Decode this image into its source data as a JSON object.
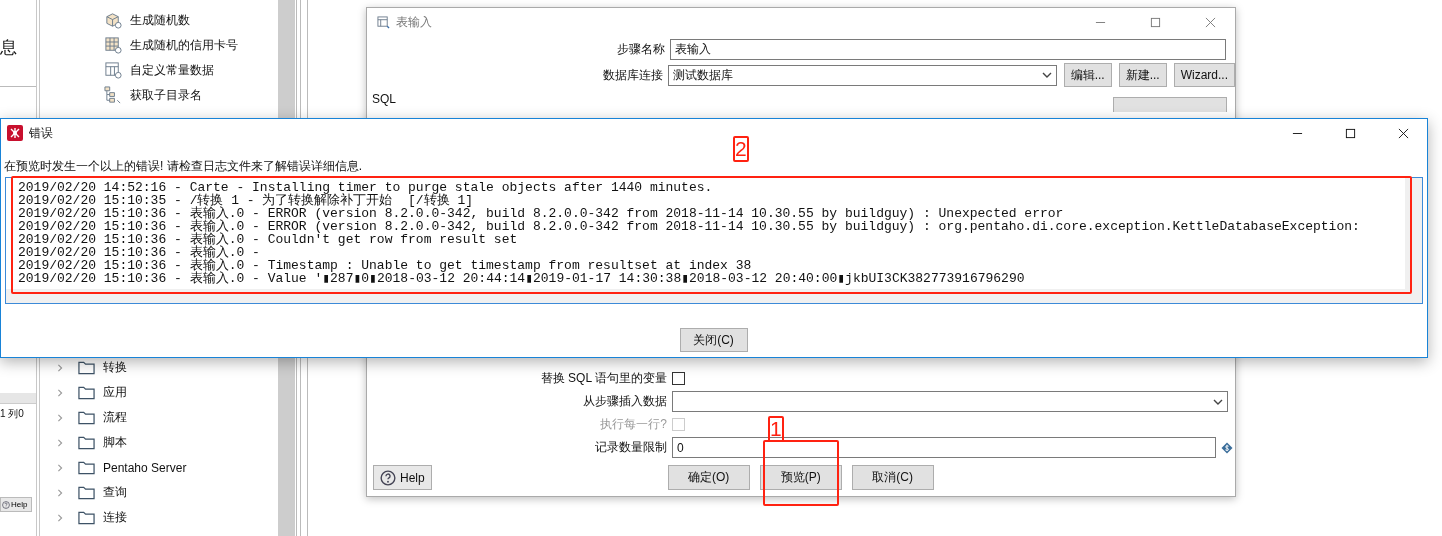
{
  "background_app": {
    "left_panel": {
      "title_fragment": "息",
      "status_fragment": "1 列0",
      "help_button": "Help"
    },
    "tree_top": [
      {
        "label": "生成随机数",
        "kind": "cube"
      },
      {
        "label": "生成随机的信用卡号",
        "kind": "grid"
      },
      {
        "label": "自定义常量数据",
        "kind": "table"
      },
      {
        "label": "获取子目录名",
        "kind": "folders"
      }
    ],
    "tree_bottom": [
      {
        "label": "转换",
        "expanded": false
      },
      {
        "label": "应用",
        "expanded": false
      },
      {
        "label": "流程",
        "expanded": false
      },
      {
        "label": "脚本",
        "expanded": false
      },
      {
        "label": "Pentaho Server",
        "expanded": false
      },
      {
        "label": "查询",
        "expanded": false
      },
      {
        "label": "连接",
        "expanded": false
      }
    ]
  },
  "table_input_dialog": {
    "title": "表输入",
    "step_name_label": "步骤名称",
    "step_name": "表输入",
    "connection_label": "数据库连接",
    "connection": "测试数据库",
    "connection_buttons": [
      "编辑...",
      "新建...",
      "Wizard..."
    ],
    "sql_label": "SQL",
    "replace_vars_label": "替换 SQL 语句里的变量",
    "replace_vars_checked": false,
    "insert_from_step_label": "从步骤插入数据",
    "execute_each_row_label": "执行每一行?",
    "execute_each_row": {
      "checked": false,
      "disabled": true
    },
    "limit_label": "记录数量限制",
    "limit": "0",
    "help_button": "Help",
    "buttons": [
      "确定(O)",
      "预览(P)",
      "取消(C)"
    ]
  },
  "error_dialog": {
    "title": "错误",
    "message": "在预览时发生一个以上的错误!  请检查日志文件来了解错误详细信息.",
    "log_lines": [
      "2019/02/20 14:52:16 - Carte - Installing timer to purge stale objects after 1440 minutes.",
      "2019/02/20 15:10:35 - /转换 1 - 为了转换解除补丁开始  [/转换 1]",
      "2019/02/20 15:10:36 - 表输入.0 - ERROR (version 8.2.0.0-342, build 8.2.0.0-342 from 2018-11-14 10.30.55 by buildguy) : Unexpected error",
      "2019/02/20 15:10:36 - 表输入.0 - ERROR (version 8.2.0.0-342, build 8.2.0.0-342 from 2018-11-14 10.30.55 by buildguy) : org.pentaho.di.core.exception.KettleDatabaseException:",
      "2019/02/20 15:10:36 - 表输入.0 - Couldn't get row from result set",
      "2019/02/20 15:10:36 - 表输入.0 -",
      "2019/02/20 15:10:36 - 表输入.0 - Timestamp : Unable to get timestamp from resultset at index 38",
      "2019/02/20 15:10:36 - 表输入.0 - Value '▮287▮0▮2018-03-12 20:44:14▮2019-01-17 14:30:38▮2018-03-12 20:40:00▮jkbUI3CK382773916796290"
    ],
    "close_button": "关闭(C)"
  },
  "annotations": [
    {
      "label": "1"
    },
    {
      "label": "2"
    }
  ]
}
